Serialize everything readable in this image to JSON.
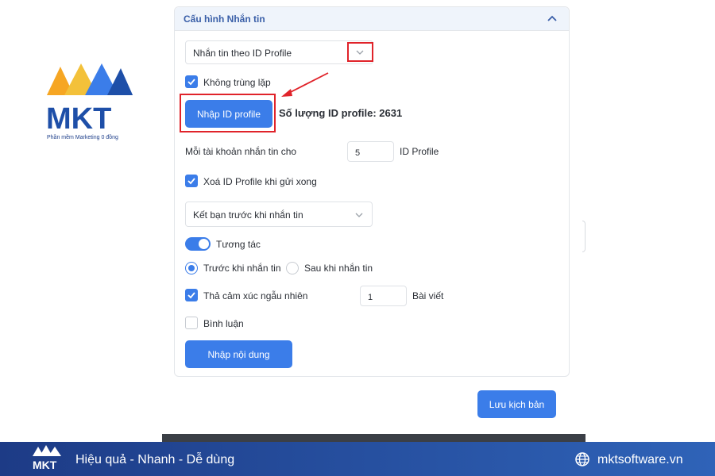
{
  "brand": {
    "logo_text": "MKT",
    "tagline": "Phần mềm Marketing 0 đồng"
  },
  "panel": {
    "title": "Cấu hình Nhắn tin",
    "message_mode_select": "Nhắn tin theo ID Profile",
    "no_duplicate_label": "Không trùng lặp",
    "import_id_button": "Nhập ID profile",
    "id_count": "Số lượng ID profile: 2631",
    "per_account_label": "Mỗi tài khoản nhắn tin cho",
    "per_account_value": "5",
    "per_account_unit": "ID Profile",
    "delete_after_send_label": "Xoá ID Profile khi gửi xong",
    "friend_select": "Kết bạn trước khi nhắn tin",
    "interact_label": "Tương tác",
    "before_label": "Trước khi nhắn tin",
    "after_label": "Sau khi nhắn tin",
    "random_react_label": "Thả cảm xúc ngẫu nhiên",
    "react_posts_value": "1",
    "react_posts_unit": "Bài viết",
    "comment_label": "Bình luận",
    "enter_content_button": "Nhập nội dung",
    "save_script_button": "Lưu kịch bản"
  },
  "state": {
    "no_duplicate_checked": true,
    "delete_after_send_checked": true,
    "interact_enabled": true,
    "timing_selected": "before",
    "random_react_checked": true,
    "comment_checked": false
  },
  "colors": {
    "accent": "#3b7de9",
    "highlight": "#e0232a",
    "footer_start": "#1d3b86",
    "footer_end": "#2f63b8",
    "title": "#3a5fa8"
  },
  "footer": {
    "slogan": "Hiệu quả - Nhanh - Dễ dùng",
    "website": "mktsoftware.vn"
  }
}
